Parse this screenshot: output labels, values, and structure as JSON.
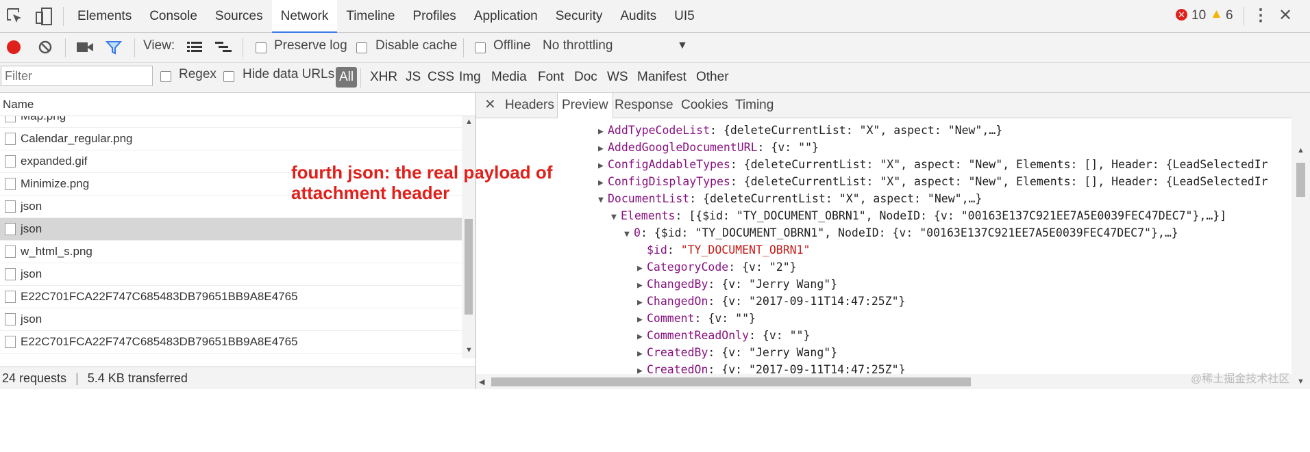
{
  "topbar": {
    "tabs": [
      "Elements",
      "Console",
      "Sources",
      "Network",
      "Timeline",
      "Profiles",
      "Application",
      "Security",
      "Audits",
      "UI5"
    ],
    "active_tab": "Network",
    "errors": "10",
    "warnings": "6"
  },
  "toolbar": {
    "view_label": "View:",
    "preserve_log": "Preserve log",
    "disable_cache": "Disable cache",
    "offline": "Offline",
    "throttling": "No throttling"
  },
  "filterbar": {
    "placeholder": "Filter",
    "regex": "Regex",
    "hide_data_urls": "Hide data URLs",
    "types": [
      "All",
      "XHR",
      "JS",
      "CSS",
      "Img",
      "Media",
      "Font",
      "Doc",
      "WS",
      "Manifest",
      "Other"
    ]
  },
  "left": {
    "name_header": "Name",
    "rows": [
      {
        "name": "Map.png",
        "icon": "image-icon"
      },
      {
        "name": "Calendar_regular.png",
        "icon": "image-icon"
      },
      {
        "name": "expanded.gif",
        "icon": "image-icon"
      },
      {
        "name": "Minimize.png",
        "icon": "image-icon"
      },
      {
        "name": "json",
        "icon": "document-icon"
      },
      {
        "name": "json",
        "icon": "document-icon"
      },
      {
        "name": "w_html_s.png",
        "icon": "image-icon"
      },
      {
        "name": "json",
        "icon": "document-icon"
      },
      {
        "name": "E22C701FCA22F747C685483DB79651BB9A8E4765",
        "icon": "document-icon"
      },
      {
        "name": "json",
        "icon": "document-icon"
      },
      {
        "name": "E22C701FCA22F747C685483DB79651BB9A8E4765",
        "icon": "document-icon"
      }
    ],
    "status_requests": "24 requests",
    "status_transferred": "5.4 KB transferred",
    "annotation_line1": "fourth json: the real payload of",
    "annotation_line2": "attachment header"
  },
  "right": {
    "tabs": [
      "Headers",
      "Preview",
      "Response",
      "Cookies",
      "Timing"
    ],
    "active_tab": "Preview",
    "tree": [
      {
        "indent": 0,
        "tri": "▶",
        "key": "AddTypeCodeList",
        "rest": ": {deleteCurrentList: \"X\", aspect: \"New\",…}"
      },
      {
        "indent": 0,
        "tri": "▶",
        "key": "AddedGoogleDocumentURL",
        "rest": ": {v: \"\"}"
      },
      {
        "indent": 0,
        "tri": "▶",
        "key": "ConfigAddableTypes",
        "rest": ": {deleteCurrentList: \"X\", aspect: \"New\", Elements: [], Header: {LeadSelectedIr"
      },
      {
        "indent": 0,
        "tri": "▶",
        "key": "ConfigDisplayTypes",
        "rest": ": {deleteCurrentList: \"X\", aspect: \"New\", Elements: [], Header: {LeadSelectedIr"
      },
      {
        "indent": 0,
        "tri": "▼",
        "key": "DocumentList",
        "rest": ": {deleteCurrentList: \"X\", aspect: \"New\",…}"
      },
      {
        "indent": 1,
        "tri": "▼",
        "key": "Elements",
        "rest": ": [{$id: \"TY_DOCUMENT_OBRN1\", NodeID: {v: \"00163E137C921EE7A5E0039FEC47DEC7\"},…}]"
      },
      {
        "indent": 2,
        "tri": "▼",
        "key": "0",
        "rest": ": {$id: \"TY_DOCUMENT_OBRN1\", NodeID: {v: \"00163E137C921EE7A5E0039FEC47DEC7\"},…}"
      },
      {
        "indent": 3,
        "tri": "",
        "key": "$id",
        "rest": ": ",
        "str": "\"TY_DOCUMENT_OBRN1\""
      },
      {
        "indent": 3,
        "tri": "▶",
        "key": "CategoryCode",
        "rest": ": {v: \"2\"}"
      },
      {
        "indent": 3,
        "tri": "▶",
        "key": "ChangedBy",
        "rest": ": {v: \"Jerry Wang\"}"
      },
      {
        "indent": 3,
        "tri": "▶",
        "key": "ChangedOn",
        "rest": ": {v: \"2017-09-11T14:47:25Z\"}"
      },
      {
        "indent": 3,
        "tri": "▶",
        "key": "Comment",
        "rest": ": {v: \"\"}"
      },
      {
        "indent": 3,
        "tri": "▶",
        "key": "CommentReadOnly",
        "rest": ": {v: \"\"}"
      },
      {
        "indent": 3,
        "tri": "▶",
        "key": "CreatedBy",
        "rest": ": {v: \"Jerry Wang\"}"
      },
      {
        "indent": 3,
        "tri": "▶",
        "key": "CreatedOn",
        "rest": ": {v: \"2017-09-11T14:47:25Z\"}"
      }
    ]
  },
  "watermark": "@稀土掘金技术社区",
  "colors": {
    "record": "#e0201b",
    "accent": "#3b78e7",
    "key": "#881280",
    "string": "#c41a16",
    "annotation": "#e0201b"
  }
}
